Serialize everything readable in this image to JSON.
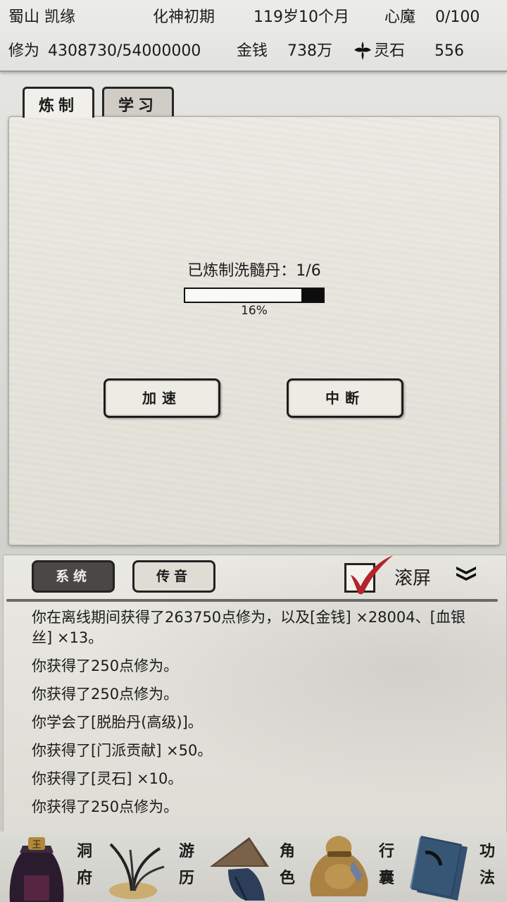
{
  "status": {
    "sect_name": "蜀山 凯缘",
    "realm": "化神初期",
    "age": "119岁10个月",
    "heart_demon_label": "心魔",
    "heart_demon_value": "0/100",
    "cultivation_label": "修为",
    "cultivation_value": "4308730/54000000",
    "money_label": "金钱",
    "money_value": "738万",
    "spirit_stone_label": "灵石",
    "spirit_stone_value": "556",
    "spirit_stone_icon": "cross-star-icon"
  },
  "tabs": [
    {
      "label": "炼制",
      "active": true
    },
    {
      "label": "学习",
      "active": false
    }
  ],
  "crafting": {
    "status_text": "已炼制洗髓丹：1/6",
    "progress": 0.16,
    "progress_text": "16%",
    "speed_button": "加速",
    "stop_button": "中断"
  },
  "log": {
    "tab_system": "系统",
    "tab_message": "传音",
    "autoscroll_label": "滚屏",
    "autoscroll_checked": true,
    "lines": [
      "你在离线期间获得了263750点修为，以及[金钱] ×28004、[血银丝] ×13。",
      "你获得了250点修为。",
      "你获得了250点修为。",
      "你学会了[脱胎丹(高级)]。",
      "你获得了[门派贡献] ×50。",
      "你获得了[灵石] ×10。",
      "你获得了250点修为。"
    ]
  },
  "nav": [
    {
      "label1": "洞",
      "label2": "府",
      "icon": "cave-dwelling-icon"
    },
    {
      "label1": "游",
      "label2": "历",
      "icon": "grass-herb-icon"
    },
    {
      "label1": "角",
      "label2": "色",
      "icon": "bamboo-hat-icon"
    },
    {
      "label1": "行",
      "label2": "囊",
      "icon": "money-bag-icon"
    },
    {
      "label1": "功",
      "label2": "法",
      "icon": "books-icon"
    }
  ],
  "colors": {
    "accent_check": "#b3242b",
    "panel_bg": "#e6e5dd",
    "ink": "#1b1b1b"
  }
}
